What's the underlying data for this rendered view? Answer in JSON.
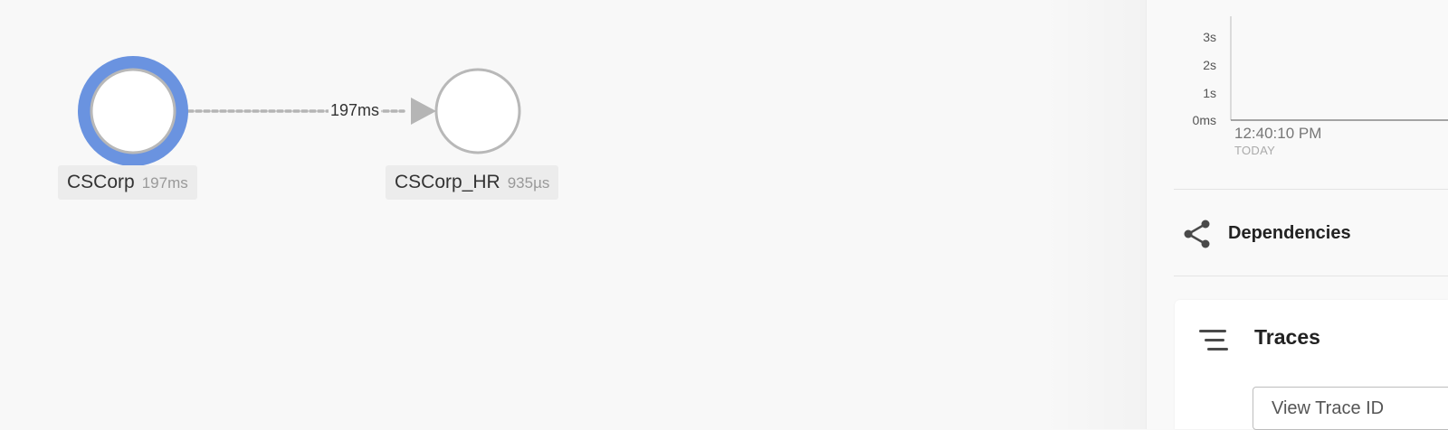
{
  "graph": {
    "nodes": [
      {
        "name": "CSCorp",
        "latency": "197ms",
        "selected": true
      },
      {
        "name": "CSCorp_HR",
        "latency": "935µs",
        "selected": false
      }
    ],
    "edges": [
      {
        "from": "CSCorp",
        "to": "CSCorp_HR",
        "label": "197ms"
      }
    ]
  },
  "chart_data": {
    "type": "line",
    "y_ticks": [
      "3s",
      "2s",
      "1s",
      "0ms"
    ],
    "x_ticks": [
      "12:40:10 PM"
    ],
    "x_subtitle": "TODAY"
  },
  "panel": {
    "dependencies": {
      "label": "Dependencies",
      "icon": "share-icon"
    },
    "traces": {
      "title": "Traces",
      "icon": "list-lines-icon",
      "input_placeholder": "View Trace ID"
    }
  },
  "colors": {
    "selected_ring": "#6a93e0",
    "node_stroke": "#b8b8b8",
    "edge": "#b5b5b5"
  }
}
